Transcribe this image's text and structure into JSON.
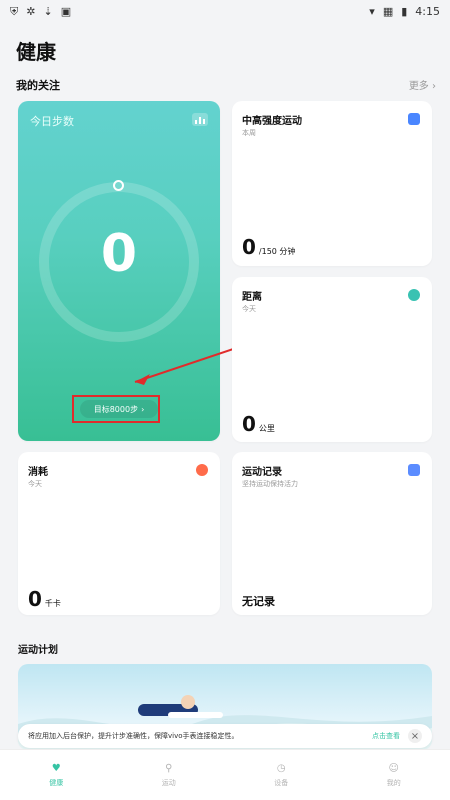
{
  "status": {
    "time": "4:15",
    "left_icons": [
      "shield-icon",
      "bug-icon",
      "download-icon",
      "box-icon"
    ],
    "right_icons": [
      "wifi-icon",
      "sim-icon",
      "battery-icon"
    ]
  },
  "header": {
    "title": "健康"
  },
  "focus": {
    "label": "我的关注",
    "more": "更多"
  },
  "cards": {
    "steps": {
      "title": "今日步数",
      "value": "0",
      "goal_button": "目标8000步"
    },
    "intensity": {
      "title": "中高强度运动",
      "sub": "本周",
      "value": "0",
      "unit": "/150 分钟"
    },
    "distance": {
      "title": "距离",
      "sub": "今天",
      "value": "0",
      "unit": "公里"
    },
    "calories": {
      "title": "消耗",
      "sub": "今天",
      "value": "0",
      "unit": "千卡"
    },
    "records": {
      "title": "运动记录",
      "sub": "坚持运动保持活力",
      "value": "无记录"
    }
  },
  "plan": {
    "label": "运动计划"
  },
  "toast": {
    "text": "将应用加入后台保护，提升计步准确性，保障vivo手表连接稳定性。",
    "link": "点击查看"
  },
  "nav": [
    {
      "label": "健康",
      "icon": "heart-pulse-icon",
      "active": true
    },
    {
      "label": "运动",
      "icon": "runner-icon",
      "active": false
    },
    {
      "label": "设备",
      "icon": "watch-icon",
      "active": false
    },
    {
      "label": "我的",
      "icon": "user-icon",
      "active": false
    }
  ],
  "colors": {
    "accent": "#36c4a4",
    "highlight": "#e12b2b"
  }
}
